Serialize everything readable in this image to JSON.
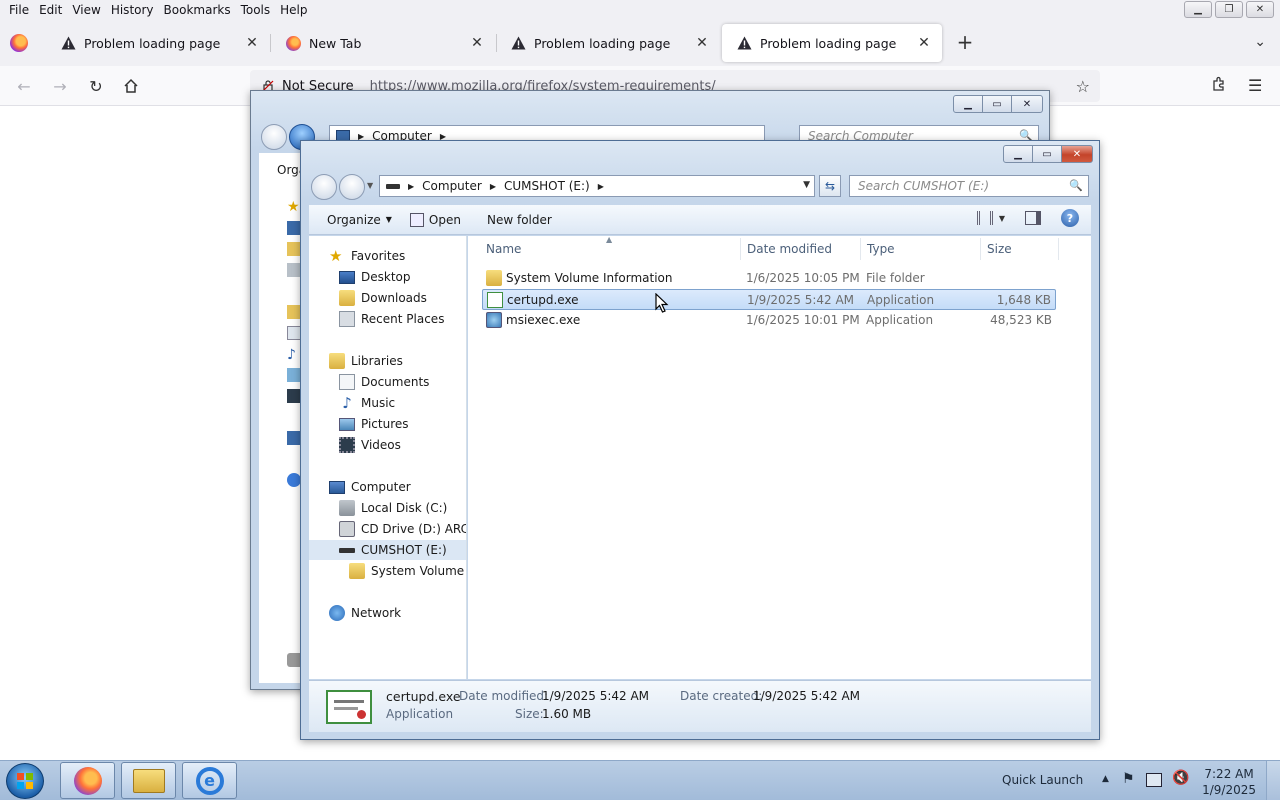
{
  "browser": {
    "menu": [
      "File",
      "Edit",
      "View",
      "History",
      "Bookmarks",
      "Tools",
      "Help"
    ],
    "tabs": [
      {
        "label": "Problem loading page",
        "icon": "warning-icon"
      },
      {
        "label": "New Tab",
        "icon": "firefox-icon"
      },
      {
        "label": "Problem loading page",
        "icon": "warning-icon"
      },
      {
        "label": "Problem loading page",
        "icon": "warning-icon",
        "active": true
      }
    ],
    "security_label": "Not Secure",
    "url": "https://www.mozilla.org/firefox/system-requirements/"
  },
  "back_window": {
    "address": [
      "Computer"
    ],
    "search_placeholder": "Search Computer",
    "toolbar_partial": "Orga"
  },
  "explorer": {
    "address": [
      "Computer",
      "CUMSHOT (E:)"
    ],
    "search_placeholder": "Search CUMSHOT (E:)",
    "toolbar": {
      "organize": "Organize",
      "open": "Open",
      "new_folder": "New folder"
    },
    "nav": {
      "favorites": "Favorites",
      "desktop": "Desktop",
      "downloads": "Downloads",
      "recent_places": "Recent Places",
      "libraries": "Libraries",
      "documents": "Documents",
      "music": "Music",
      "pictures": "Pictures",
      "videos": "Videos",
      "computer": "Computer",
      "local_disk": "Local Disk (C:)",
      "cd_drive": "CD Drive (D:) ARCA_",
      "cumshot": "CUMSHOT (E:)",
      "sys_vol": "System Volume In",
      "network": "Network"
    },
    "columns": {
      "name": "Name",
      "date": "Date modified",
      "type": "Type",
      "size": "Size"
    },
    "files": [
      {
        "name": "System Volume Information",
        "date": "1/6/2025 10:05 PM",
        "type": "File folder",
        "size": ""
      },
      {
        "name": "certupd.exe",
        "date": "1/9/2025 5:42 AM",
        "type": "Application",
        "size": "1,648 KB"
      },
      {
        "name": "msiexec.exe",
        "date": "1/6/2025 10:01 PM",
        "type": "Application",
        "size": "48,523 KB"
      }
    ],
    "details": {
      "filename": "certupd.exe",
      "kind": "Application",
      "modified_label": "Date modified:",
      "modified_value": "1/9/2025 5:42 AM",
      "created_label": "Date created:",
      "created_value": "1/9/2025 5:42 AM",
      "size_label": "Size:",
      "size_value": "1.60 MB"
    }
  },
  "taskbar": {
    "quick_launch": "Quick Launch",
    "time": "7:22 AM",
    "date": "1/9/2025"
  }
}
